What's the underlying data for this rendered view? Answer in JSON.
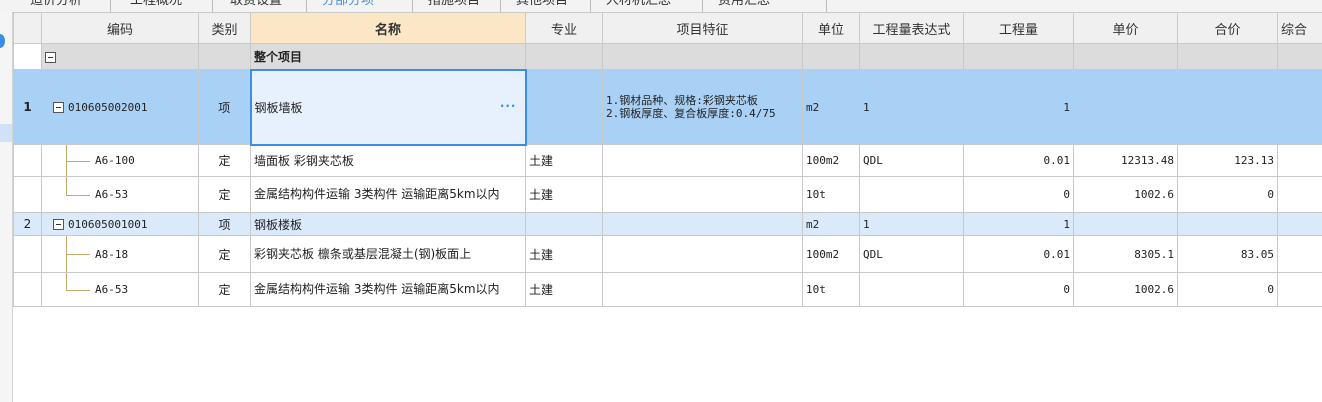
{
  "tabs": [
    {
      "label": "造价分析"
    },
    {
      "label": "工程概况"
    },
    {
      "label": "取费设置"
    },
    {
      "label": "分部分项"
    },
    {
      "label": "措施项目"
    },
    {
      "label": "其他项目"
    },
    {
      "label": "人材机汇总"
    },
    {
      "label": "费用汇总"
    }
  ],
  "columns": {
    "code": "编码",
    "type": "类别",
    "name": "名称",
    "major": "专业",
    "feature": "项目特征",
    "unit": "单位",
    "expr": "工程量表达式",
    "qty": "工程量",
    "price": "单价",
    "total": "合价",
    "extra": "综合"
  },
  "group_row": {
    "name": "整个项目"
  },
  "rows": [
    {
      "index": "1",
      "code": "010605002001",
      "type": "项",
      "name": "钢板墙板",
      "ellipsis": "···",
      "major": "",
      "feature": "1.钢材品种、规格:彩钢夹芯板\n2.钢板厚度、复合板厚度:0.4/75",
      "unit": "m2",
      "expr": "1",
      "qty": "1",
      "price": "",
      "total": ""
    },
    {
      "index": "",
      "code": "A6-100",
      "type": "定",
      "name": "墙面板 彩钢夹芯板",
      "major": "土建",
      "feature": "",
      "unit": "100m2",
      "expr": "QDL",
      "qty": "0.01",
      "price": "12313.48",
      "total": "123.13"
    },
    {
      "index": "",
      "code": "A6-53",
      "type": "定",
      "name": "金属结构构件运输 3类构件 运输距离5km以内",
      "major": "土建",
      "feature": "",
      "unit": "10t",
      "expr": "",
      "qty": "0",
      "price": "1002.6",
      "total": "0"
    },
    {
      "index": "2",
      "code": "010605001001",
      "type": "项",
      "name": "钢板楼板",
      "major": "",
      "feature": "",
      "unit": "m2",
      "expr": "1",
      "qty": "1",
      "price": "",
      "total": ""
    },
    {
      "index": "",
      "code": "A8-18",
      "type": "定",
      "name": "彩钢夹芯板 檩条或基层混凝土(钢)板面上",
      "major": "土建",
      "feature": "",
      "unit": "100m2",
      "expr": "QDL",
      "qty": "0.01",
      "price": "8305.1",
      "total": "83.05"
    },
    {
      "index": "",
      "code": "A6-53",
      "type": "定",
      "name": "金属结构构件运输 3类构件 运输距离5km以内",
      "major": "土建",
      "feature": "",
      "unit": "10t",
      "expr": "",
      "qty": "0",
      "price": "1002.6",
      "total": "0"
    }
  ],
  "colors": {
    "selected_row": "#a9d0f5",
    "alt_row": "#dbeafb",
    "group_row": "#dcdcdc",
    "selected_header": "#fbe7c6",
    "accent": "#3a8ee6"
  }
}
